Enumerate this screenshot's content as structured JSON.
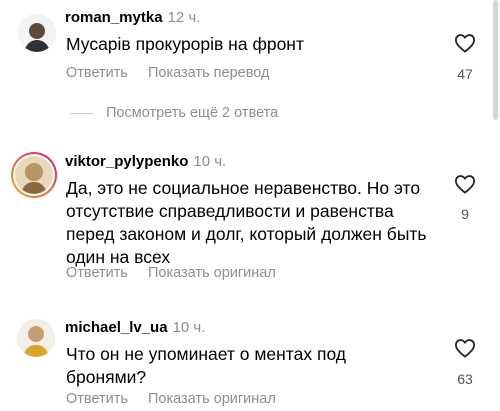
{
  "comments": [
    {
      "username": "roman_mytka",
      "time": "12 ч.",
      "text": "Мусарів прокурорів на фронт",
      "reply_label": "Ответить",
      "translate_label": "Показать перевод",
      "likes": "47"
    },
    {
      "username": "viktor_pylypenko",
      "time": "10 ч.",
      "text": "Да, это не социальное неравенство. Но это отсутствие справедливости и равенства перед законом и долг, который должен быть один на всех",
      "reply_label": "Ответить",
      "translate_label": "Показать оригинал",
      "likes": "9"
    },
    {
      "username": "michael_lv_ua",
      "time": "10 ч.",
      "text": "Что он не упоминает о ментах под бронями?",
      "reply_label": "Ответить",
      "translate_label": "Показать оригинал",
      "likes": "63"
    }
  ],
  "more_replies_label": "Посмотреть ещё 2 ответа",
  "colors": {
    "secondary_text": "#8e8e8e",
    "primary_text": "#000000",
    "story_ring_start": "#f9a825",
    "story_ring_end": "#d81b60"
  },
  "icons": {
    "like": "heart-outline-icon"
  }
}
